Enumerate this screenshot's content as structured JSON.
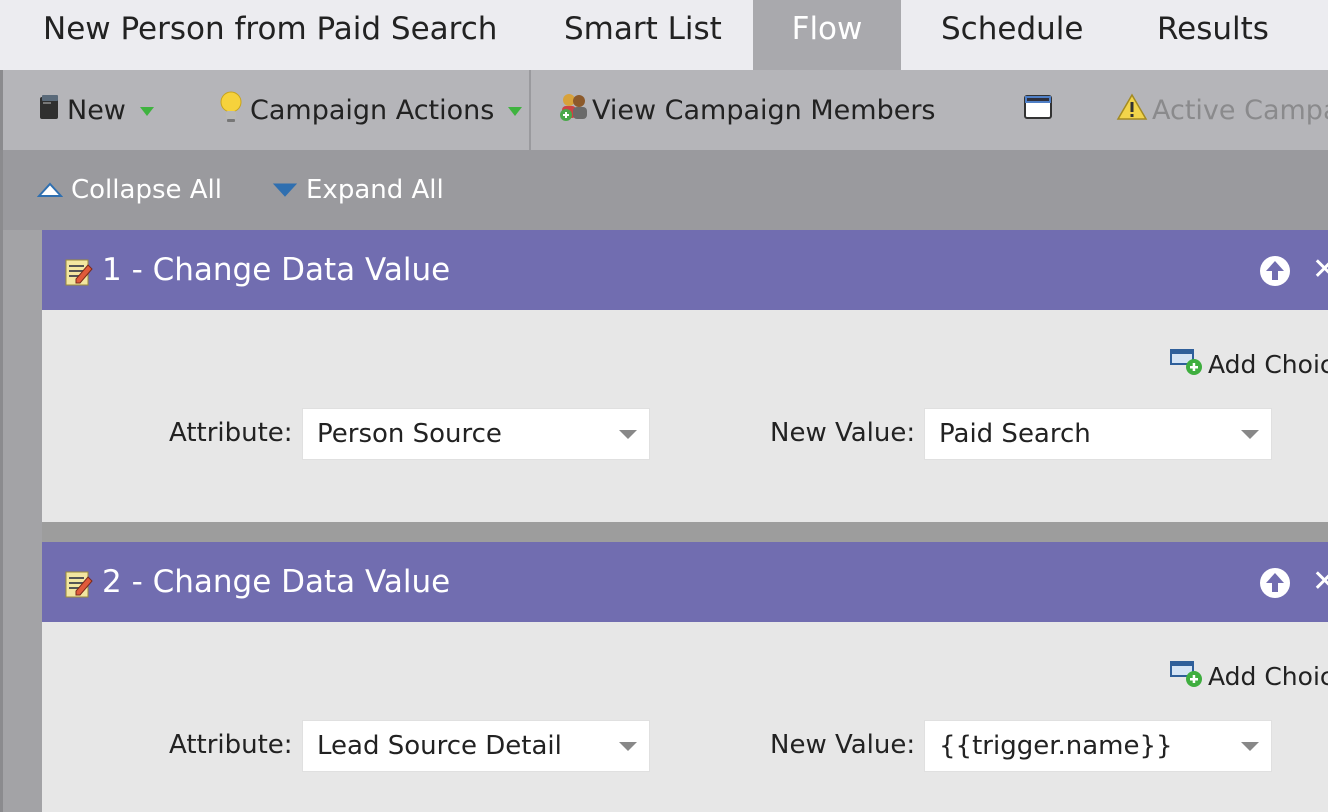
{
  "tabs": {
    "campaign_name": "New Person from Paid Search",
    "smart_list": "Smart List",
    "flow": "Flow",
    "schedule": "Schedule",
    "results": "Results",
    "active_tab": "Flow"
  },
  "toolbar": {
    "new_label": "New",
    "campaign_actions_label": "Campaign Actions",
    "view_members_label": "View Campaign Members",
    "active_label": "Active Campaig"
  },
  "subbar": {
    "collapse_label": "Collapse All",
    "expand_label": "Expand All"
  },
  "steps": [
    {
      "title": "1 - Change Data Value",
      "add_choice_label": "Add Choic",
      "attribute_label": "Attribute:",
      "attribute_value": "Person Source",
      "new_value_label": "New Value:",
      "new_value": "Paid Search"
    },
    {
      "title": "2 - Change Data Value",
      "add_choice_label": "Add Choic",
      "attribute_label": "Attribute:",
      "attribute_value": "Lead Source Detail",
      "new_value_label": "New Value:",
      "new_value": "{{trigger.name}}"
    }
  ],
  "colors": {
    "step_header": "#716db0",
    "active_tab": "#a9a9ad",
    "dropdown_triangle": "#3fb33f"
  }
}
